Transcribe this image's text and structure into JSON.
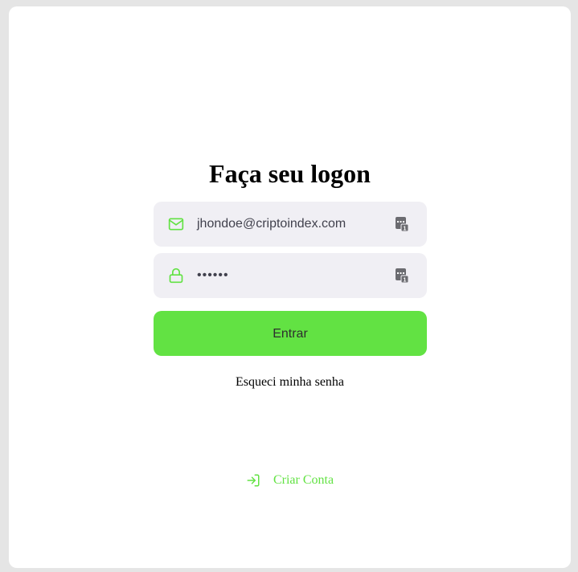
{
  "form": {
    "title": "Faça seu logon",
    "email": {
      "value": "jhondoe@criptoindex.com",
      "lead_icon": "mail-icon",
      "trail_icon": "password-manager-icon"
    },
    "password": {
      "value": "••••••",
      "lead_icon": "lock-icon",
      "trail_icon": "password-manager-icon"
    },
    "submit_label": "Entrar",
    "forgot_label": "Esqueci minha senha"
  },
  "create_account": {
    "label": "Criar Conta",
    "icon": "log-in-icon"
  },
  "colors": {
    "accent": "#62e243",
    "input_bg": "#f0eff4",
    "page_bg": "#e5e5e5",
    "card_bg": "#ffffff"
  }
}
